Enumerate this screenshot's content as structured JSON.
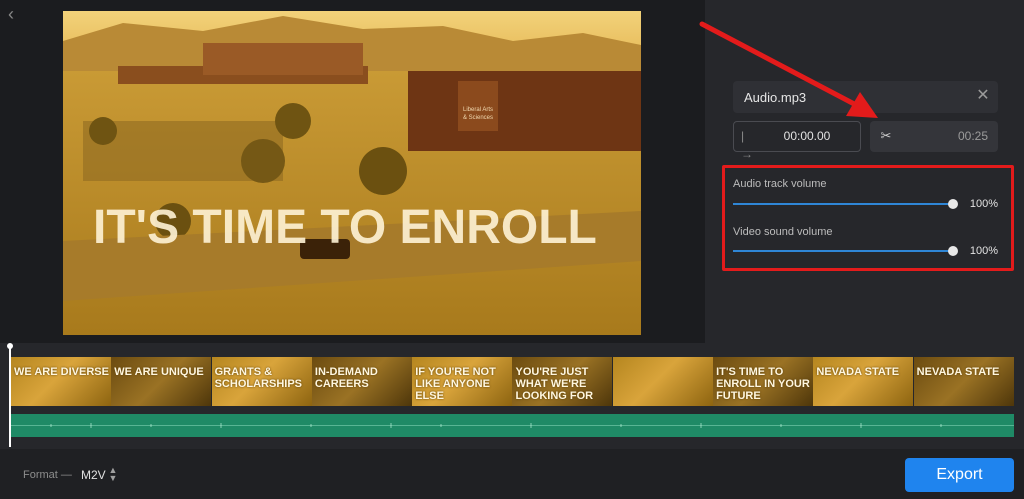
{
  "preview": {
    "overlay_text": "IT'S TIME TO ENROLL",
    "sign_line1": "Liberal Arts",
    "sign_line2": "& Sciences"
  },
  "audio": {
    "filename": "Audio.mp3",
    "start_time": "00:00.00",
    "end_time": "00:25"
  },
  "volume": {
    "audio_track_label": "Audio track volume",
    "audio_track_value": "100%",
    "audio_track_level": 1.0,
    "video_sound_label": "Video sound volume",
    "video_sound_value": "100%",
    "video_sound_level": 1.0
  },
  "timeline": {
    "clips": [
      {
        "text": "WE ARE DIVERSE"
      },
      {
        "text": "WE ARE UNIQUE"
      },
      {
        "text": "GRANTS & SCHOLARSHIPS"
      },
      {
        "text": "IN-DEMAND CAREERS"
      },
      {
        "text": "IF YOU'RE NOT LIKE ANYONE ELSE"
      },
      {
        "text": "YOU'RE JUST WHAT WE'RE LOOKING FOR"
      },
      {
        "text": ""
      },
      {
        "text": "IT'S TIME TO ENROLL IN YOUR FUTURE"
      },
      {
        "text": "Nevada State"
      },
      {
        "text": "Nevada State"
      }
    ]
  },
  "footer": {
    "format_label": "Format —",
    "format_value": "M2V",
    "export_label": "Export"
  },
  "colors": {
    "accent": "#1f84ee",
    "highlight_frame": "#e31b1b",
    "audio_track": "#1f8a66"
  },
  "icons": {
    "back": "chevron-left-icon",
    "close": "close-icon",
    "start": "trim-start-icon",
    "scissors": "scissors-icon",
    "format": "up-down-chevron-icon"
  }
}
